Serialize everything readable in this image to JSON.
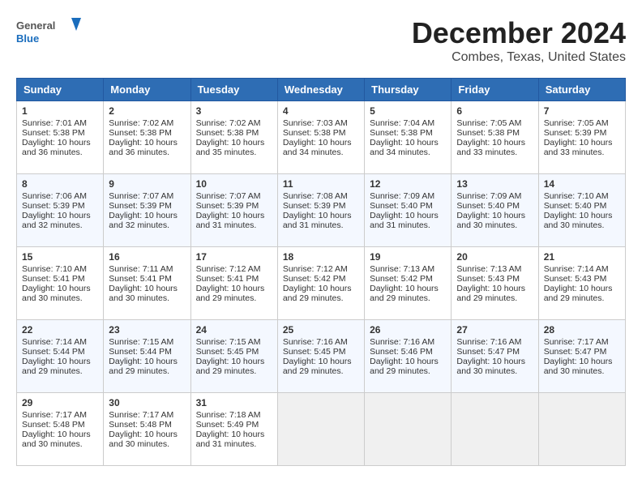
{
  "header": {
    "logo_line1": "General",
    "logo_line2": "Blue",
    "title": "December 2024",
    "subtitle": "Combes, Texas, United States"
  },
  "days_of_week": [
    "Sunday",
    "Monday",
    "Tuesday",
    "Wednesday",
    "Thursday",
    "Friday",
    "Saturday"
  ],
  "weeks": [
    [
      {
        "day": 1,
        "sunrise": "7:01 AM",
        "sunset": "5:38 PM",
        "daylight": "10 hours and 36 minutes."
      },
      {
        "day": 2,
        "sunrise": "7:02 AM",
        "sunset": "5:38 PM",
        "daylight": "10 hours and 36 minutes."
      },
      {
        "day": 3,
        "sunrise": "7:02 AM",
        "sunset": "5:38 PM",
        "daylight": "10 hours and 35 minutes."
      },
      {
        "day": 4,
        "sunrise": "7:03 AM",
        "sunset": "5:38 PM",
        "daylight": "10 hours and 34 minutes."
      },
      {
        "day": 5,
        "sunrise": "7:04 AM",
        "sunset": "5:38 PM",
        "daylight": "10 hours and 34 minutes."
      },
      {
        "day": 6,
        "sunrise": "7:05 AM",
        "sunset": "5:38 PM",
        "daylight": "10 hours and 33 minutes."
      },
      {
        "day": 7,
        "sunrise": "7:05 AM",
        "sunset": "5:39 PM",
        "daylight": "10 hours and 33 minutes."
      }
    ],
    [
      {
        "day": 8,
        "sunrise": "7:06 AM",
        "sunset": "5:39 PM",
        "daylight": "10 hours and 32 minutes."
      },
      {
        "day": 9,
        "sunrise": "7:07 AM",
        "sunset": "5:39 PM",
        "daylight": "10 hours and 32 minutes."
      },
      {
        "day": 10,
        "sunrise": "7:07 AM",
        "sunset": "5:39 PM",
        "daylight": "10 hours and 31 minutes."
      },
      {
        "day": 11,
        "sunrise": "7:08 AM",
        "sunset": "5:39 PM",
        "daylight": "10 hours and 31 minutes."
      },
      {
        "day": 12,
        "sunrise": "7:09 AM",
        "sunset": "5:40 PM",
        "daylight": "10 hours and 31 minutes."
      },
      {
        "day": 13,
        "sunrise": "7:09 AM",
        "sunset": "5:40 PM",
        "daylight": "10 hours and 30 minutes."
      },
      {
        "day": 14,
        "sunrise": "7:10 AM",
        "sunset": "5:40 PM",
        "daylight": "10 hours and 30 minutes."
      }
    ],
    [
      {
        "day": 15,
        "sunrise": "7:10 AM",
        "sunset": "5:41 PM",
        "daylight": "10 hours and 30 minutes."
      },
      {
        "day": 16,
        "sunrise": "7:11 AM",
        "sunset": "5:41 PM",
        "daylight": "10 hours and 30 minutes."
      },
      {
        "day": 17,
        "sunrise": "7:12 AM",
        "sunset": "5:41 PM",
        "daylight": "10 hours and 29 minutes."
      },
      {
        "day": 18,
        "sunrise": "7:12 AM",
        "sunset": "5:42 PM",
        "daylight": "10 hours and 29 minutes."
      },
      {
        "day": 19,
        "sunrise": "7:13 AM",
        "sunset": "5:42 PM",
        "daylight": "10 hours and 29 minutes."
      },
      {
        "day": 20,
        "sunrise": "7:13 AM",
        "sunset": "5:43 PM",
        "daylight": "10 hours and 29 minutes."
      },
      {
        "day": 21,
        "sunrise": "7:14 AM",
        "sunset": "5:43 PM",
        "daylight": "10 hours and 29 minutes."
      }
    ],
    [
      {
        "day": 22,
        "sunrise": "7:14 AM",
        "sunset": "5:44 PM",
        "daylight": "10 hours and 29 minutes."
      },
      {
        "day": 23,
        "sunrise": "7:15 AM",
        "sunset": "5:44 PM",
        "daylight": "10 hours and 29 minutes."
      },
      {
        "day": 24,
        "sunrise": "7:15 AM",
        "sunset": "5:45 PM",
        "daylight": "10 hours and 29 minutes."
      },
      {
        "day": 25,
        "sunrise": "7:16 AM",
        "sunset": "5:45 PM",
        "daylight": "10 hours and 29 minutes."
      },
      {
        "day": 26,
        "sunrise": "7:16 AM",
        "sunset": "5:46 PM",
        "daylight": "10 hours and 29 minutes."
      },
      {
        "day": 27,
        "sunrise": "7:16 AM",
        "sunset": "5:47 PM",
        "daylight": "10 hours and 30 minutes."
      },
      {
        "day": 28,
        "sunrise": "7:17 AM",
        "sunset": "5:47 PM",
        "daylight": "10 hours and 30 minutes."
      }
    ],
    [
      {
        "day": 29,
        "sunrise": "7:17 AM",
        "sunset": "5:48 PM",
        "daylight": "10 hours and 30 minutes."
      },
      {
        "day": 30,
        "sunrise": "7:17 AM",
        "sunset": "5:48 PM",
        "daylight": "10 hours and 30 minutes."
      },
      {
        "day": 31,
        "sunrise": "7:18 AM",
        "sunset": "5:49 PM",
        "daylight": "10 hours and 31 minutes."
      },
      null,
      null,
      null,
      null
    ]
  ]
}
